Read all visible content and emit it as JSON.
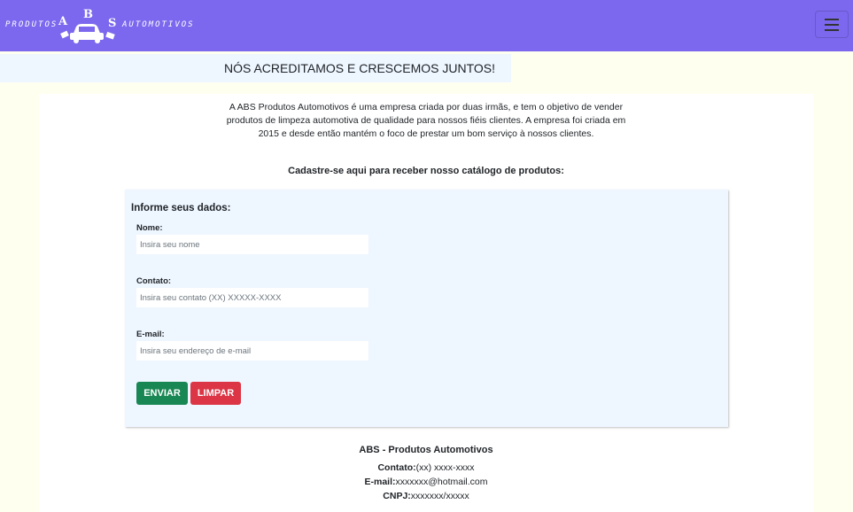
{
  "brand": {
    "left_text": "PRODUTOS",
    "right_text": "AUTOMOTIVOS",
    "letters": [
      "A",
      "B",
      "S"
    ]
  },
  "banner": {
    "text": "NÓS ACREDITAMOS E CRESCEMOS JUNTOS!"
  },
  "about": {
    "text": "A ABS Produtos Automotivos é uma empresa criada por duas irmãs, e tem o objetivo de vender produtos de limpeza automotiva de qualidade para nossos fiéis clientes. A empresa foi criada em 2015 e desde então mantém o foco de prestar um bom serviço à nossos clientes."
  },
  "cta": "Cadastre-se aqui para receber nosso catálogo de produtos:",
  "form": {
    "title": "Informe seus dados:",
    "name_label": "Nome:",
    "name_placeholder": "Insira seu nome",
    "contact_label": "Contato:",
    "contact_placeholder": "Insira seu contato (XX) XXXXX-XXXX",
    "email_label": "E-mail:",
    "email_placeholder": "Insira seu endereço de e-mail",
    "send_label": "ENVIAR",
    "clear_label": "LIMPAR"
  },
  "footer": {
    "title": "ABS - Produtos Automotivos",
    "contact_key": "Contato:",
    "contact_value": "(xx) xxxx-xxxx",
    "email_key": "E-mail:",
    "email_value": "xxxxxxx@hotmail.com",
    "cnpj_key": "CNPJ:",
    "cnpj_value": "xxxxxxx/xxxxx"
  },
  "colors": {
    "navbar": "#7b68ee",
    "banner": "#eef6ff",
    "page": "#fffff0",
    "send": "#198754",
    "clear": "#dc3545"
  },
  "icons": [
    "car-logo-icon",
    "hamburger-menu-icon"
  ]
}
